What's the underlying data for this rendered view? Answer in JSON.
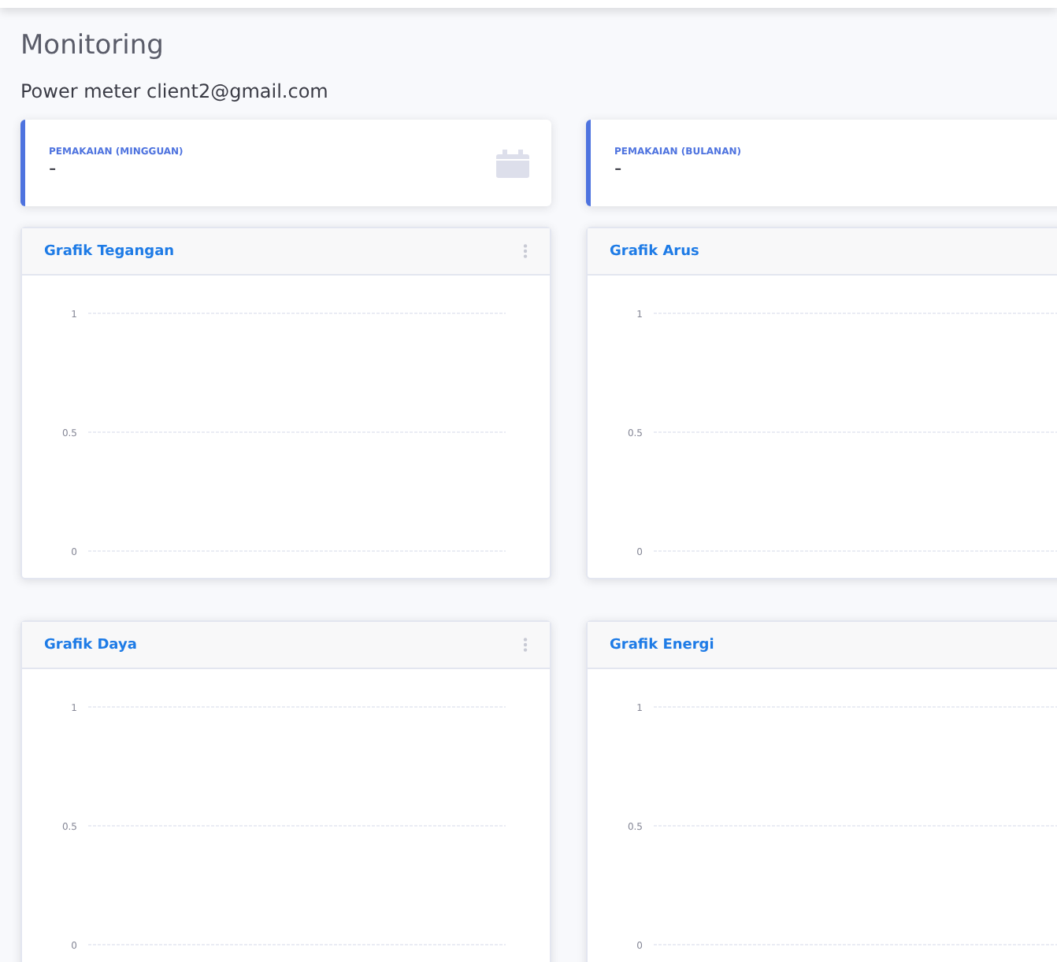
{
  "page": {
    "title": "Monitoring",
    "subtitle": "Power meter client2@gmail.com"
  },
  "stats": [
    {
      "label": "PEMAKAIAN (MINGGUAN)",
      "value": "-"
    },
    {
      "label": "PEMAKAIAN (BULANAN)",
      "value": "-"
    }
  ],
  "charts": [
    {
      "title": "Grafik Tegangan",
      "axis_labels": [
        "1",
        "0.5",
        "0"
      ]
    },
    {
      "title": "Grafik Arus",
      "axis_labels": [
        "1",
        "0.5",
        "0"
      ]
    },
    {
      "title": "Grafik Daya",
      "axis_labels": [
        "1",
        "0.5",
        "0"
      ]
    },
    {
      "title": "Grafik Energi",
      "axis_labels": [
        "1",
        "0.5",
        "0"
      ]
    }
  ]
}
